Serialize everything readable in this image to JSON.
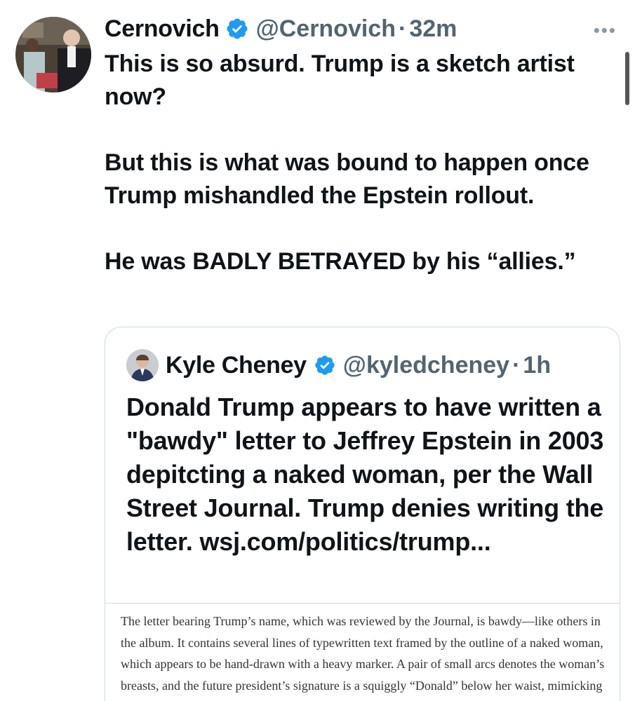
{
  "tweet": {
    "author_name": "Cernovich",
    "handle": "@Cernovich",
    "separator": "·",
    "time": "32m",
    "more_icon": "•••",
    "avatar_icon": "profile-photo",
    "verified_icon": "verified-badge-icon",
    "paragraphs": [
      "This is so absurd. Trump is a sketch artist now?",
      "But this is what was bound to happen once Trump mishandled the Epstein rollout.",
      "He was BADLY BETRAYED by his “allies.”"
    ]
  },
  "quote": {
    "author_name": "Kyle Cheney",
    "handle": "@kyledcheney",
    "separator": "·",
    "time": "1h",
    "text": "Donald Trump appears to have written a \"bawdy\" letter to Jeffrey Epstein in 2003 depitcting a naked woman, per the Wall Street Journal. Trump denies writing the letter. wsj.com/politics/trump...",
    "media": {
      "excerpt": "The letter bearing Trump’s name, which was reviewed by the Journal, is bawdy—like others in the album. It contains several lines of typewritten text framed by the outline of a naked woman, which appears to be hand-drawn with a heavy marker. A pair of small arcs denotes the woman’s breasts, and the future president’s signature is a squiggly “Donald” below her waist, mimicking pubic hair."
    }
  },
  "colors": {
    "accent": "#1d9bf0",
    "text": "#0f1419",
    "secondary": "#536471",
    "border": "#cfd9de"
  }
}
